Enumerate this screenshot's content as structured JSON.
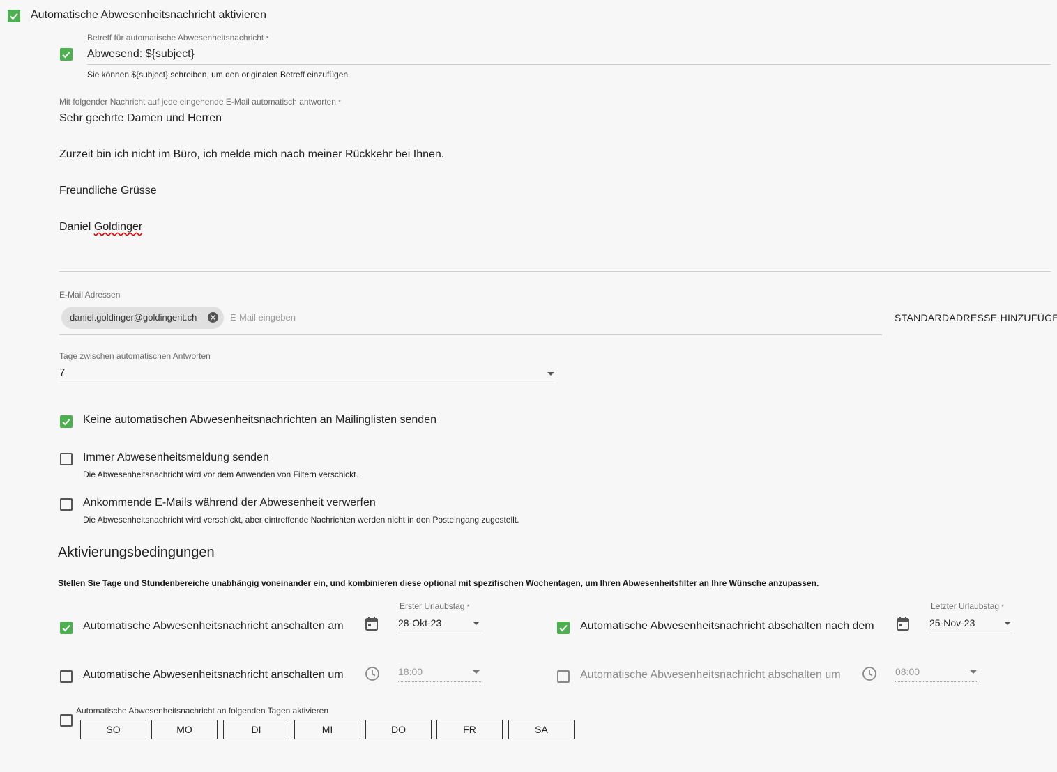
{
  "vacation": {
    "enable_label": "Automatische Abwesenheitsnachricht aktivieren",
    "subject": {
      "label": "Betreff für automatische Abwesenheitsnachricht",
      "required_mark": "*",
      "value": "Abwesend: ${subject}",
      "hint": "Sie können ${subject} schreiben, um den originalen Betreff einzufügen"
    },
    "message": {
      "label": "Mit folgender Nachricht auf jede eingehende E-Mail automatisch antworten",
      "required_mark": "*",
      "lines": [
        "Sehr geehrte Damen und Herren",
        "Zurzeit bin ich nicht im Büro, ich melde mich nach meiner Rückkehr bei Ihnen.",
        "Freundliche Grüsse",
        "Daniel",
        "Goldinger"
      ]
    },
    "addresses": {
      "label": "E-Mail Adressen",
      "chip": "daniel.goldinger@goldingerit.ch",
      "placeholder": "E-Mail eingeben",
      "add_default_button": "STANDARDADRESSE HINZUFÜGEN"
    },
    "days_between": {
      "label": "Tage zwischen automatischen Antworten",
      "value": "7"
    },
    "no_mailinglists": {
      "label": "Keine automatischen Abwesenheitsnachrichten an Mailinglisten senden",
      "checked": true
    },
    "always_send": {
      "label": "Immer Abwesenheitsmeldung senden",
      "hint": "Die Abwesenheitsnachricht wird vor dem Anwenden von Filtern verschickt.",
      "checked": false
    },
    "discard": {
      "label": "Ankommende E-Mails während der Abwesenheit verwerfen",
      "hint": "Die Abwesenheitsnachricht wird verschickt, aber eintreffende Nachrichten werden nicht in den Posteingang zugestellt.",
      "checked": false
    },
    "conditions": {
      "heading": "Aktivierungsbedingungen",
      "description": "Stellen Sie Tage und Stundenbereiche unabhängig voneinander ein, und kombinieren diese optional mit spezifischen Wochentagen, um Ihren Abwesenheitsfilter an Ihre Wünsche anzupassen.",
      "start_date": {
        "label": "Automatische Abwesenheitsnachricht anschalten am",
        "field_label": "Erster Urlaubstag",
        "required_mark": "*",
        "value": "28-Okt-23",
        "checked": true
      },
      "end_date": {
        "label": "Automatische Abwesenheitsnachricht abschalten nach dem",
        "field_label": "Letzter Urlaubstag",
        "required_mark": "*",
        "value": "25-Nov-23",
        "checked": true
      },
      "start_time": {
        "label": "Automatische Abwesenheitsnachricht anschalten um",
        "value": "18:00",
        "checked": false
      },
      "end_time": {
        "label": "Automatische Abwesenheitsnachricht abschalten um",
        "value": "08:00",
        "checked": false
      },
      "weekdays": {
        "label": "Automatische Abwesenheitsnachricht an folgenden Tagen aktivieren",
        "checked": false,
        "days": [
          "SO",
          "MO",
          "DI",
          "MI",
          "DO",
          "FR",
          "SA"
        ]
      }
    }
  },
  "colors": {
    "accent": "#4caf50",
    "background": "#f7f7f7"
  }
}
